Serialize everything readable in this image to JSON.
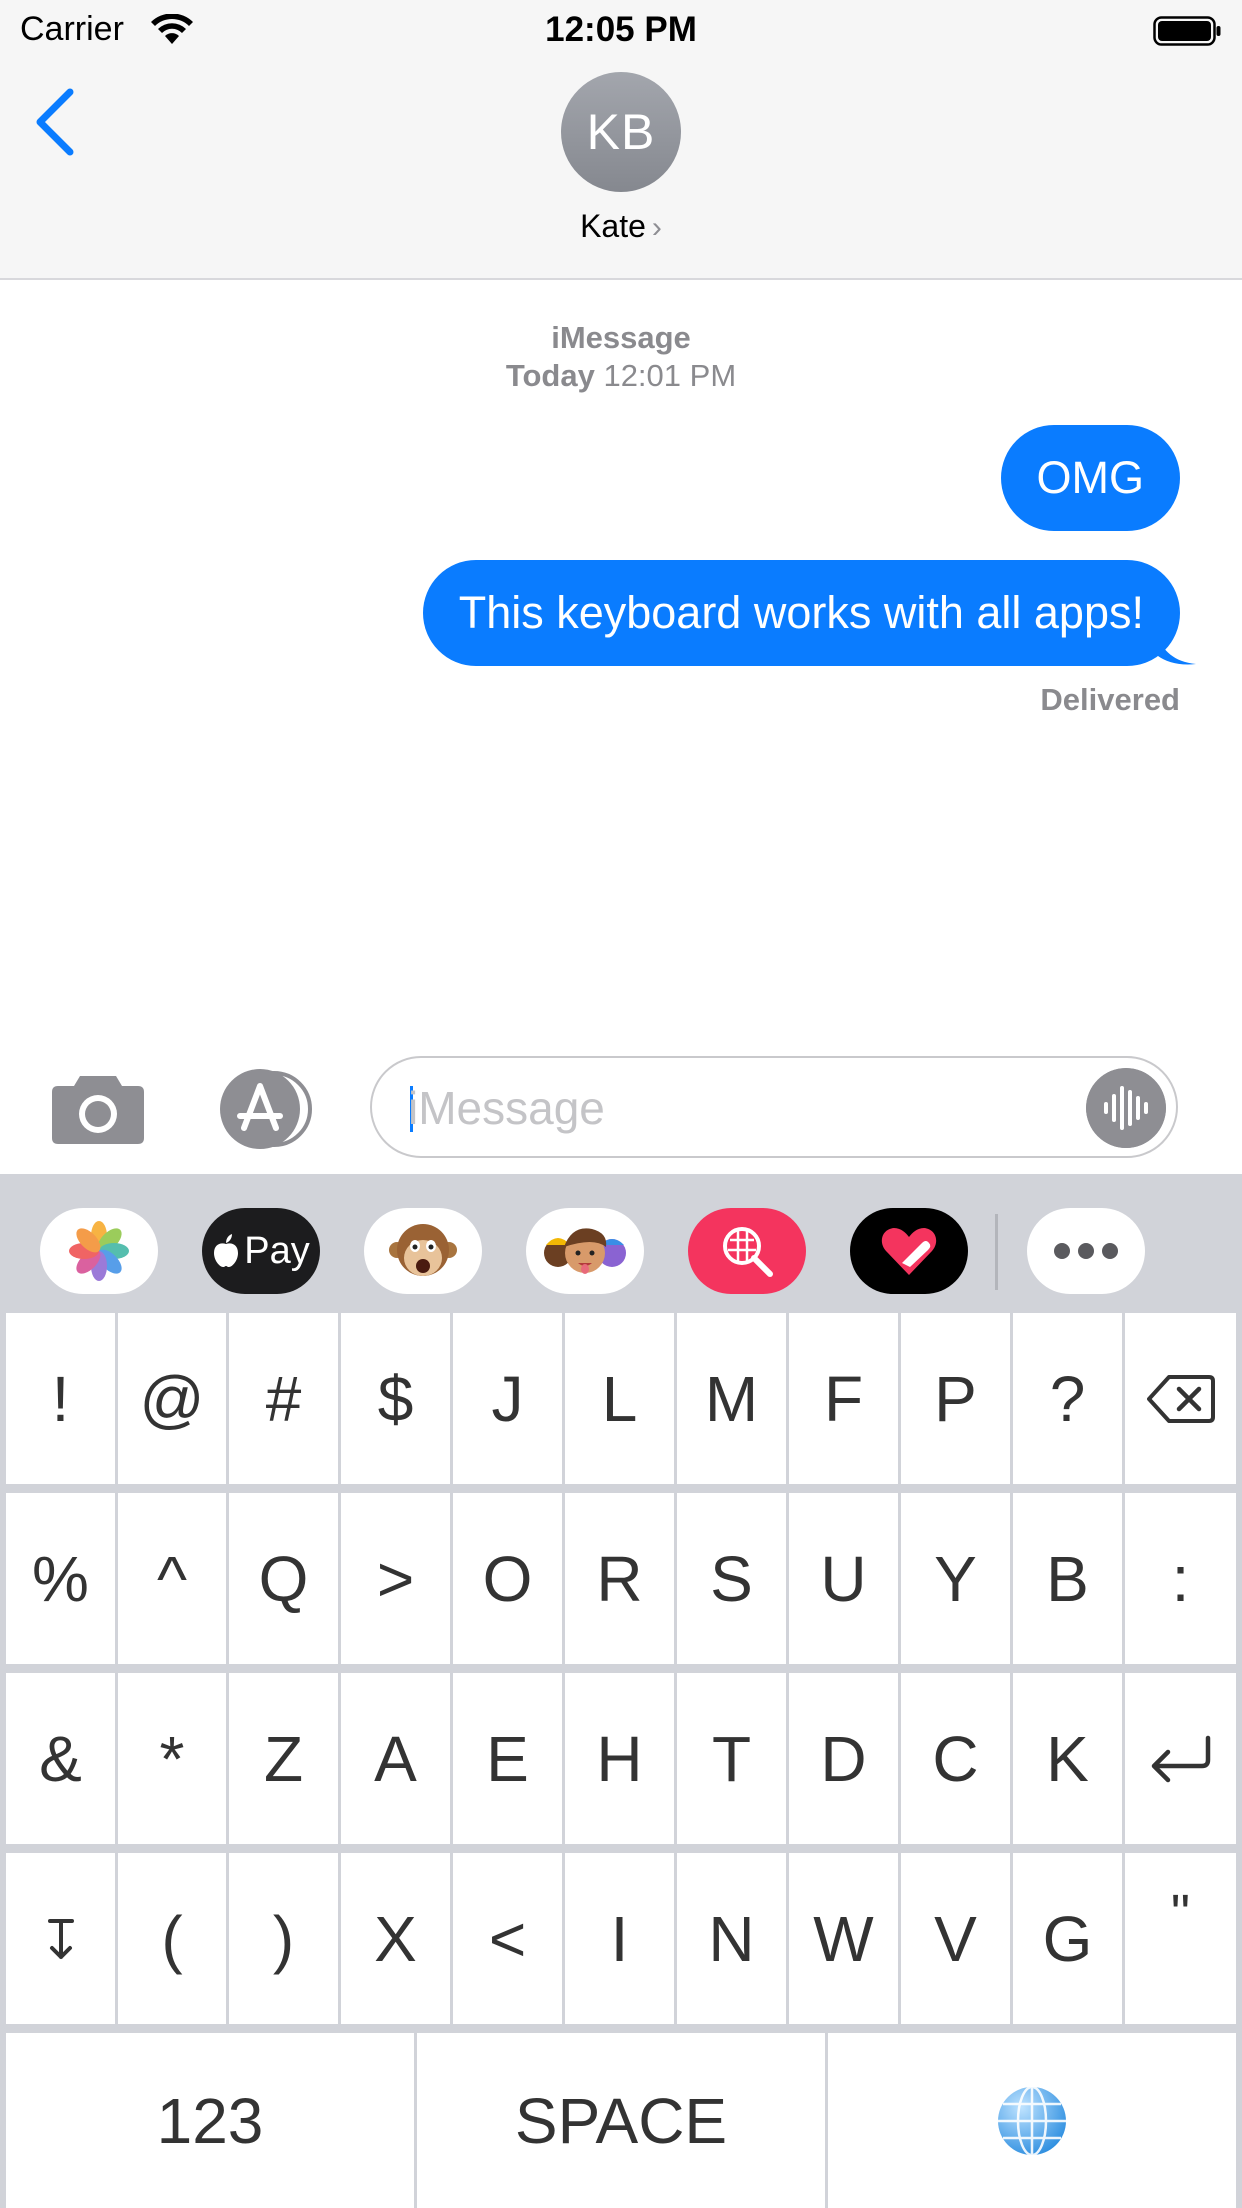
{
  "status_bar": {
    "carrier": "Carrier",
    "time": "12:05 PM"
  },
  "header": {
    "avatar_initials": "KB",
    "contact_name": "Kate",
    "chevron": "›"
  },
  "conversation": {
    "service": "iMessage",
    "timestamp_day": "Today",
    "timestamp_time": "12:01 PM",
    "messages": [
      {
        "text": "OMG",
        "from": "me"
      },
      {
        "text": "This keyboard works with all apps!",
        "from": "me"
      }
    ],
    "delivery_status": "Delivered"
  },
  "compose": {
    "placeholder": "iMessage",
    "value": ""
  },
  "apps": [
    {
      "name": "photos-icon"
    },
    {
      "name": "apple-pay-icon",
      "label": "Pay"
    },
    {
      "name": "animoji-monkey-icon"
    },
    {
      "name": "memoji-icon"
    },
    {
      "name": "image-search-icon"
    },
    {
      "name": "digital-touch-icon"
    },
    {
      "name": "more-apps-icon"
    }
  ],
  "keyboard": {
    "rows": [
      [
        "!",
        "@",
        "#",
        "$",
        "J",
        "L",
        "M",
        "F",
        "P",
        "?",
        "⌫"
      ],
      [
        "%",
        "^",
        "Q",
        ">",
        "O",
        "R",
        "S",
        "U",
        "Y",
        "B",
        ":"
      ],
      [
        "&",
        "*",
        "Z",
        "A",
        "E",
        "H",
        "T",
        "D",
        "C",
        "K",
        "↵"
      ],
      [
        "↧",
        "(",
        ")",
        "X",
        "<",
        "I",
        "N",
        "W",
        "V",
        "G",
        "\""
      ]
    ],
    "bottom": {
      "numbers": "123",
      "space": "SPACE",
      "globe": "🌐"
    }
  },
  "colors": {
    "accent": "#0a7cff",
    "keyboard_bg": "#d1d3d9",
    "key_bg": "#ffffff",
    "meta_text": "#8a8a8e"
  }
}
